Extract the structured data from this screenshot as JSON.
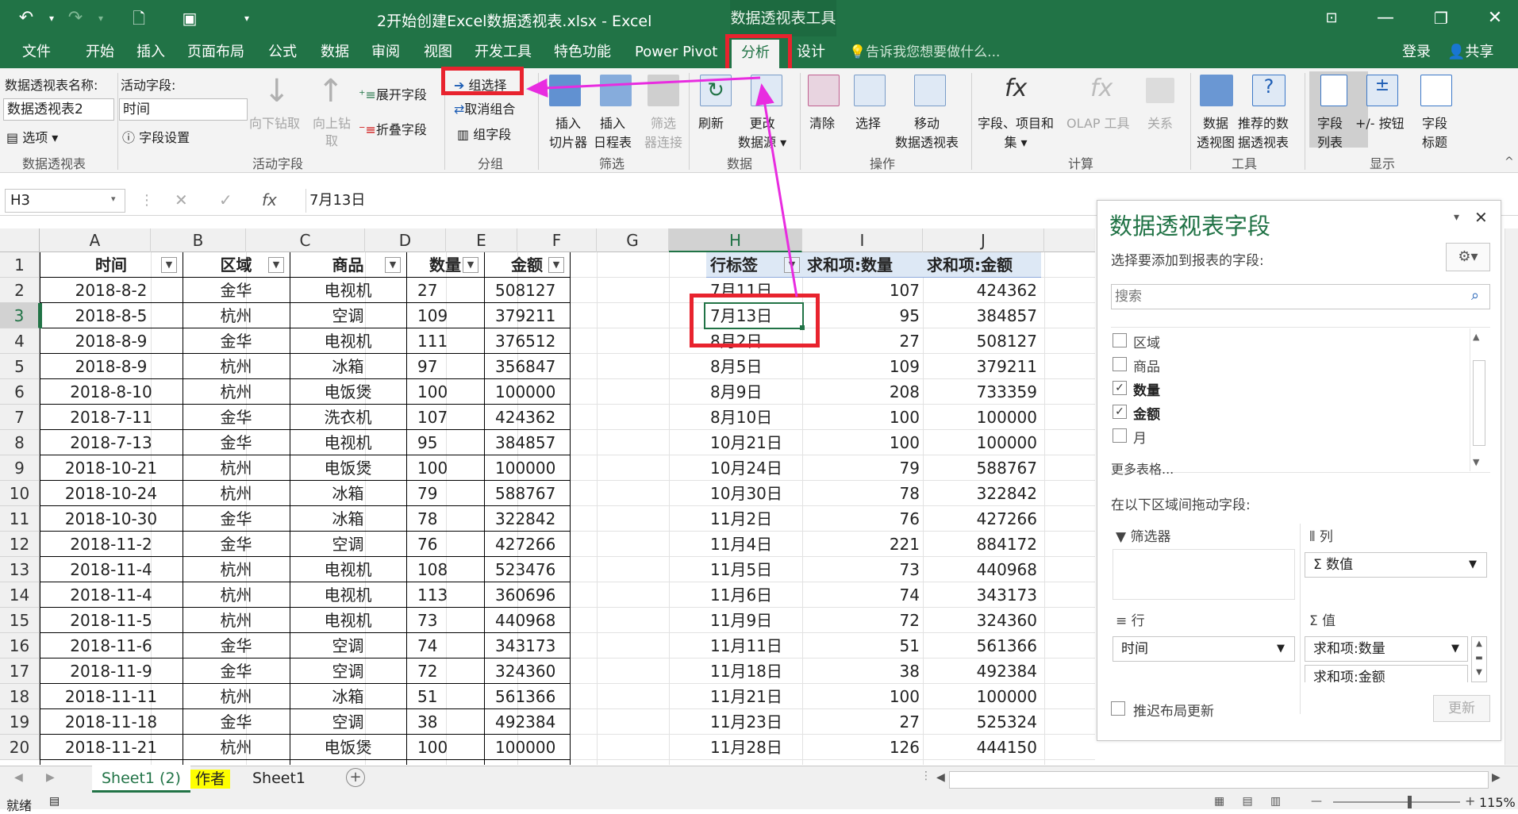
{
  "titlebar": {
    "title": "2开始创建Excel数据透视表.xlsx - Excel",
    "context": "数据透视表工具"
  },
  "tabs": [
    "文件",
    "开始",
    "插入",
    "页面布局",
    "公式",
    "数据",
    "审阅",
    "视图",
    "开发工具",
    "特色功能",
    "Power Pivot",
    "分析",
    "设计"
  ],
  "tell_me": "告诉我您想要做什么...",
  "signin": "登录",
  "share": "共享",
  "ribbon": {
    "pivot_name_label": "数据透视表名称:",
    "pivot_name": "数据透视表2",
    "options": "选项",
    "active_field_label": "活动字段:",
    "active_field": "时间",
    "field_settings": "字段设置",
    "drill_down": "向下钻取",
    "drill_up": "向上钻",
    "drill_up2": "取",
    "expand": "展开字段",
    "collapse": "折叠字段",
    "group_selection": "组选择",
    "ungroup": "取消组合",
    "group_field": "组字段",
    "insert_slicer1": "插入",
    "insert_slicer2": "切片器",
    "insert_timeline1": "插入",
    "insert_timeline2": "日程表",
    "filter_conn1": "筛选",
    "filter_conn2": "器连接",
    "refresh": "刷新",
    "change_src1": "更改",
    "change_src2": "数据源",
    "clear": "清除",
    "select": "选择",
    "move1": "移动",
    "move2": "数据透视表",
    "fields_items1": "字段、项目和",
    "fields_items2": "集",
    "olap": "OLAP 工具",
    "relations": "关系",
    "pivotchart1": "数据",
    "pivotchart2": "透视图",
    "recommended1": "推荐的数",
    "recommended2": "据透视表",
    "field_list1": "字段",
    "field_list2": "列表",
    "buttons": "+/- 按钮",
    "headers1": "字段",
    "headers2": "标题",
    "groups": [
      "数据透视表",
      "活动字段",
      "分组",
      "筛选",
      "数据",
      "操作",
      "计算",
      "工具",
      "显示"
    ]
  },
  "formula": {
    "namebox": "H3",
    "value": "7月13日"
  },
  "columns": [
    "A",
    "B",
    "C",
    "D",
    "E",
    "F",
    "G",
    "H",
    "I",
    "J"
  ],
  "rows": [
    "1",
    "2",
    "3",
    "4",
    "5",
    "6",
    "7",
    "8",
    "9",
    "10",
    "11",
    "12",
    "13",
    "14",
    "15",
    "16",
    "17",
    "18",
    "19",
    "20"
  ],
  "source": {
    "headers": [
      "时间",
      "区域",
      "商品",
      "数量",
      "金额"
    ],
    "data": [
      [
        "2018-8-2",
        "金华",
        "电视机",
        "27",
        "508127"
      ],
      [
        "2018-8-5",
        "杭州",
        "空调",
        "109",
        "379211"
      ],
      [
        "2018-8-9",
        "金华",
        "电视机",
        "111",
        "376512"
      ],
      [
        "2018-8-9",
        "杭州",
        "冰箱",
        "97",
        "356847"
      ],
      [
        "2018-8-10",
        "杭州",
        "电饭煲",
        "100",
        "100000"
      ],
      [
        "2018-7-11",
        "金华",
        "洗衣机",
        "107",
        "424362"
      ],
      [
        "2018-7-13",
        "金华",
        "电视机",
        "95",
        "384857"
      ],
      [
        "2018-10-21",
        "杭州",
        "电饭煲",
        "100",
        "100000"
      ],
      [
        "2018-10-24",
        "杭州",
        "冰箱",
        "79",
        "588767"
      ],
      [
        "2018-10-30",
        "金华",
        "冰箱",
        "78",
        "322842"
      ],
      [
        "2018-11-2",
        "金华",
        "空调",
        "76",
        "427266"
      ],
      [
        "2018-11-4",
        "杭州",
        "电视机",
        "108",
        "523476"
      ],
      [
        "2018-11-4",
        "杭州",
        "电视机",
        "113",
        "360696"
      ],
      [
        "2018-11-5",
        "杭州",
        "电视机",
        "73",
        "440968"
      ],
      [
        "2018-11-6",
        "金华",
        "空调",
        "74",
        "343173"
      ],
      [
        "2018-11-9",
        "金华",
        "空调",
        "72",
        "324360"
      ],
      [
        "2018-11-11",
        "杭州",
        "冰箱",
        "51",
        "561366"
      ],
      [
        "2018-11-18",
        "金华",
        "空调",
        "38",
        "492384"
      ],
      [
        "2018-11-21",
        "杭州",
        "电饭煲",
        "100",
        "100000"
      ]
    ]
  },
  "pivot": {
    "headers": [
      "行标签",
      "求和项:数量",
      "求和项:金额"
    ],
    "data": [
      [
        "7月11日",
        "107",
        "424362"
      ],
      [
        "7月13日",
        "95",
        "384857"
      ],
      [
        "8月2日",
        "27",
        "508127"
      ],
      [
        "8月5日",
        "109",
        "379211"
      ],
      [
        "8月9日",
        "208",
        "733359"
      ],
      [
        "8月10日",
        "100",
        "100000"
      ],
      [
        "10月21日",
        "100",
        "100000"
      ],
      [
        "10月24日",
        "79",
        "588767"
      ],
      [
        "10月30日",
        "78",
        "322842"
      ],
      [
        "11月2日",
        "76",
        "427266"
      ],
      [
        "11月4日",
        "221",
        "884172"
      ],
      [
        "11月5日",
        "73",
        "440968"
      ],
      [
        "11月6日",
        "74",
        "343173"
      ],
      [
        "11月9日",
        "72",
        "324360"
      ],
      [
        "11月11日",
        "51",
        "561366"
      ],
      [
        "11月18日",
        "38",
        "492384"
      ],
      [
        "11月21日",
        "100",
        "100000"
      ],
      [
        "11月23日",
        "27",
        "525324"
      ],
      [
        "11月28日",
        "126",
        "444150"
      ]
    ]
  },
  "sheets": [
    "Sheet1 (2)",
    "作者",
    "Sheet1"
  ],
  "status": {
    "ready": "就绪",
    "zoom": "115%"
  },
  "pane": {
    "title": "数据透视表字段",
    "subtitle": "选择要添加到报表的字段:",
    "search_placeholder": "搜索",
    "fields": [
      {
        "name": "区域",
        "checked": false
      },
      {
        "name": "商品",
        "checked": false
      },
      {
        "name": "数量",
        "checked": true
      },
      {
        "name": "金额",
        "checked": true
      },
      {
        "name": "月",
        "checked": false
      }
    ],
    "more_tables": "更多表格...",
    "drag_label": "在以下区域间拖动字段:",
    "filters": "筛选器",
    "columns": "列",
    "columns_item": "数值",
    "rows": "行",
    "rows_item": "时间",
    "values": "值",
    "values_item1": "求和项:数量",
    "values_item2": "求和项:金额",
    "defer": "推迟布局更新",
    "update": "更新"
  }
}
